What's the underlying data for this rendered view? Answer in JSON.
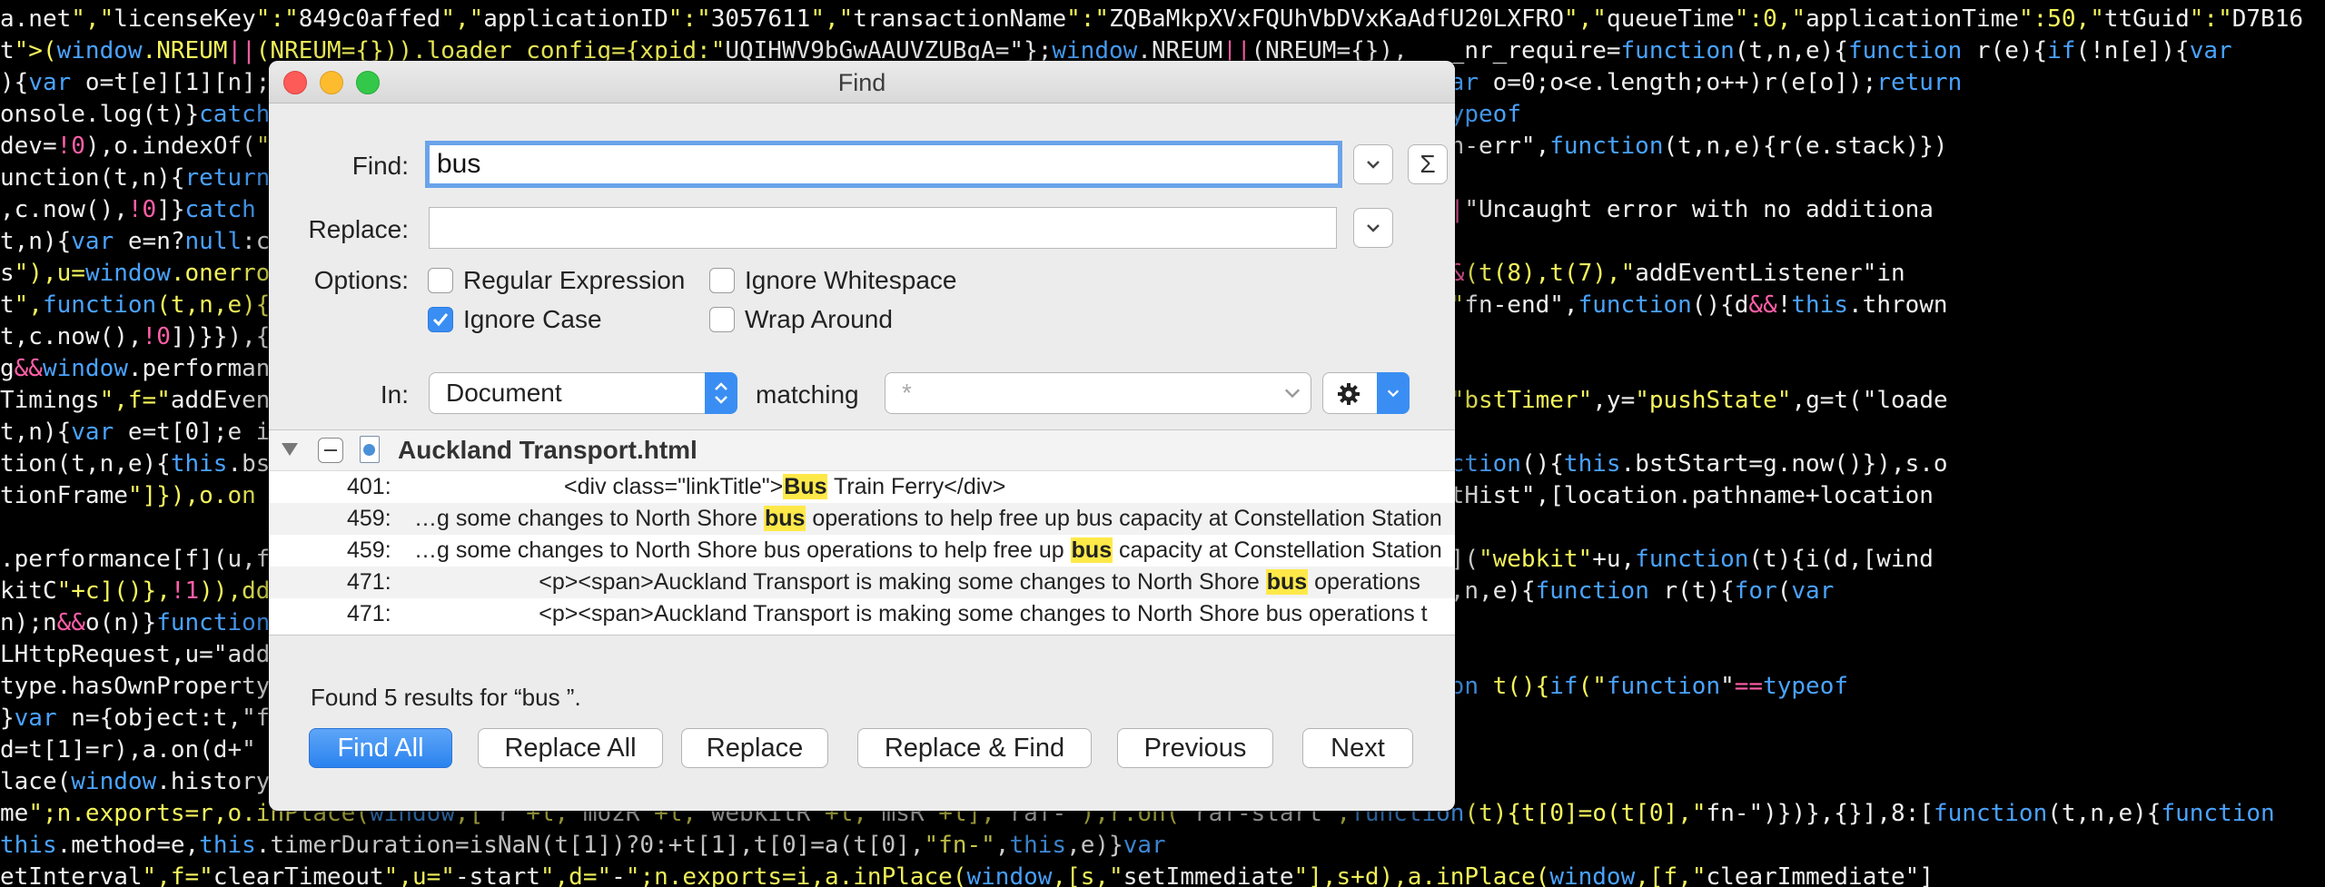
{
  "background_code": [
    "a.net\",\"licenseKey\":\"849c0affed\",\"applicationID\":\"3057611\",\"transactionName\":\"ZQBaMkpXVxFQUhVbDVxKaAdfU20LXFRO\",\"queueTime\":0,\"applicationTime\":50,\"ttGuid\":\"D7B16",
    "t\">(window.NREUM||(NREUM={})).loader_config={xpid:\"UQIHWV9bGwAAUVZUBgA=\"};window.NREUM||(NREUM={}),  __nr_require=function(t,n,e){function r(e){if(!n[e]){var",
    "){var o=t[e][1][n];                                                        e)return __nr_require;for(var o=0;o<e.length;o++)r(e[o]);return",
    "onsole.log(t)}catch                                                        ,\"\"),console&&\"function\"==typeof",
    "dev=!0),o.indexOf(\"                                                        r(t.stack)}),s.dev&&i.on(\"fn-err\",function(t,n,e){r(e.stack)})",
    "unction(t,n){return                                                        w",
    ",c.now(),!0]}catch                                                        ption(t,n,e){this.message=t||\"Uncaught error with no additiona",
    "t,n){var e=n?null:c",
    "s\"),u=window.onerro                                                        Error}catch(h){\"stack\"in h&&(t(8),t(7),\"addEventListener\"in",
    "t\",function(t,n,e){                                                        his.thrown=!0,o(e))}),s.on(\"fn-end\",function(){d&&!this.thrown",
    "t,c.now(),!0])}}),{",
    "g&&window.performan",
    "Timings\",f=\"addEven                                                        \"-end\",m=\"fn\"+p,w=\"fn\"+h,v=\"bstTimer\",y=\"pushState\",g=t(\"loade",
    "t,n){var e=t[0];e i",
    "tion(t,n,e){this.bs                                                        this.bstType])}),s.on(m,function(){this.bstStart=g.now()}),s.o",
    "tionFrame\"]}),o.on                                                        ),o.on(y+h,function(t){i(\"bstHist\",[location.pathname+location",
    "",
    ".performance[f](u,f                                                        )},!1):window.performance[f](\"webkit\"+u,function(t){i(d,[wind",
    "kitC\"+c]()},!1)),dd                                                        \",r,!1)}},{}],5:[function(t,n,e){function r(t){for(var",
    "n);n&&o(n)}function",
    "LHttpRequest,u=\"add",
    "type.hasOwnProperty                                                        @wrapped\",function(){function t(){if(\"function\"==typeof",
    "}var n={object:t,\"f",
    "d=t[1]=r),a.on(d+\"",
    "lace(window.history",
    "me\";n.exports=r,o.inPlace(window,[\"r\"+l,\"mozR\"+l,\"webkitR\"+l,\"msR\"+l],\"raf-\"),r.on(\"raf-start\",function(t){t[0]=o(t[0],\"fn-\")})},{}],8:[function(t,n,e){function",
    "this.method=e,this.timerDuration=isNaN(t[1])?0:+t[1],t[0]=a(t[0],\"fn-\",this,e)}var",
    "etInterval\",f=\"clearTimeout\",u=\"-start\",d=\"-\";n.exports=i,a.inPlace(window,[s,\"setImmediate\"],s+d),a.inPlace(window,[f,\"clearImmediate\"]"
  ],
  "dialog": {
    "title": "Find",
    "find_label": "Find:",
    "find_value": "bus",
    "sigma_icon": "Σ",
    "replace_label": "Replace:",
    "replace_value": "",
    "options_label": "Options:",
    "options": {
      "regex": {
        "label": "Regular Expression",
        "checked": false
      },
      "ignore_ws": {
        "label": "Ignore Whitespace",
        "checked": false
      },
      "ignore_case": {
        "label": "Ignore Case",
        "checked": true
      },
      "wrap": {
        "label": "Wrap Around",
        "checked": false
      }
    },
    "in_label": "In:",
    "in_value": "Document",
    "matching_label": "matching",
    "matching_value": "*",
    "file_name": "Auckland Transport.html",
    "results": [
      {
        "line": "401:",
        "before": "                  <div class=\"linkTitle\">",
        "match": "Bus",
        "after": " Train Ferry</div>"
      },
      {
        "line": "459:",
        "before": "…g some changes to North Shore ",
        "match": "bus",
        "after": " operations to help free up bus capacity at Constellation Station"
      },
      {
        "line": "459:",
        "before": "…g some changes to North Shore bus operations to help free up ",
        "match": "bus",
        "after": " capacity at Constellation Station"
      },
      {
        "line": "471:",
        "before": "              <p><span>Auckland Transport is making some changes to North Shore ",
        "match": "bus",
        "after": " operations"
      },
      {
        "line": "471:",
        "before": "              <p><span>Auckland Transport is making some changes to North Shore bus operations t",
        "match": "",
        "after": ""
      }
    ],
    "status": "Found 5 results for “bus ”.",
    "buttons": {
      "find_all": "Find All",
      "replace_all": "Replace All",
      "replace": "Replace",
      "replace_find": "Replace & Find",
      "previous": "Previous",
      "next": "Next"
    }
  },
  "colors": {
    "accent": "#3a8ef3",
    "highlight": "#ffe949"
  }
}
